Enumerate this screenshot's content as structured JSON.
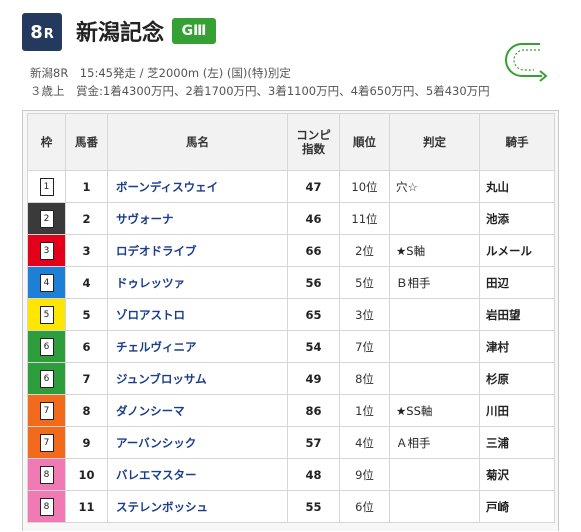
{
  "race": {
    "number": "8",
    "number_suffix": "R",
    "name": "新潟記念",
    "grade": "GⅢ",
    "info_line1": "新潟8R　15:45発走 / 芝2000m (左) (国)(特)別定",
    "info_line2": "３歳上　賞金:1着4300万円、2着1700万円、3着1100万円、4着650万円、5着430万円"
  },
  "course_icon": "left-turn-course-icon",
  "table": {
    "headers": {
      "frame": "枠",
      "num": "馬番",
      "name": "馬名",
      "comp_line1": "コンピ",
      "comp_line2": "指数",
      "rank": "順位",
      "judge": "判定",
      "jockey": "騎手"
    },
    "frame_colors": {
      "1": "#ffffff",
      "2": "#3a3a3a",
      "3": "#e3001b",
      "4": "#1e7fd6",
      "5": "#ffe600",
      "6": "#2e9e3c",
      "7": "#f26b1d",
      "8": "#ef7ab4"
    },
    "rows": [
      {
        "frame": "1",
        "num": "1",
        "name": "ボーンディスウェイ",
        "comp": "47",
        "rank": "10位",
        "judge": "穴☆",
        "jockey": "丸山"
      },
      {
        "frame": "2",
        "num": "2",
        "name": "サヴォーナ",
        "comp": "46",
        "rank": "11位",
        "judge": "",
        "jockey": "池添"
      },
      {
        "frame": "3",
        "num": "3",
        "name": "ロデオドライブ",
        "comp": "66",
        "rank": "2位",
        "judge": "★S軸",
        "jockey": "ルメール"
      },
      {
        "frame": "4",
        "num": "4",
        "name": "ドゥレッツァ",
        "comp": "56",
        "rank": "5位",
        "judge": "Ｂ相手",
        "jockey": "田辺"
      },
      {
        "frame": "5",
        "num": "5",
        "name": "ゾロアストロ",
        "comp": "65",
        "rank": "3位",
        "judge": "",
        "jockey": "岩田望"
      },
      {
        "frame": "6",
        "num": "6",
        "name": "チェルヴィニア",
        "comp": "54",
        "rank": "7位",
        "judge": "",
        "jockey": "津村"
      },
      {
        "frame": "6",
        "num": "7",
        "name": "ジュンブロッサム",
        "comp": "49",
        "rank": "8位",
        "judge": "",
        "jockey": "杉原"
      },
      {
        "frame": "7",
        "num": "8",
        "name": "ダノンシーマ",
        "comp": "86",
        "rank": "1位",
        "judge": "★SS軸",
        "jockey": "川田"
      },
      {
        "frame": "7",
        "num": "9",
        "name": "アーバンシック",
        "comp": "57",
        "rank": "4位",
        "judge": "Ａ相手",
        "jockey": "三浦"
      },
      {
        "frame": "8",
        "num": "10",
        "name": "バレエマスター",
        "comp": "48",
        "rank": "9位",
        "judge": "",
        "jockey": "菊沢"
      },
      {
        "frame": "8",
        "num": "11",
        "name": "ステレンボッシュ",
        "comp": "55",
        "rank": "6位",
        "judge": "",
        "jockey": "戸崎"
      }
    ]
  }
}
